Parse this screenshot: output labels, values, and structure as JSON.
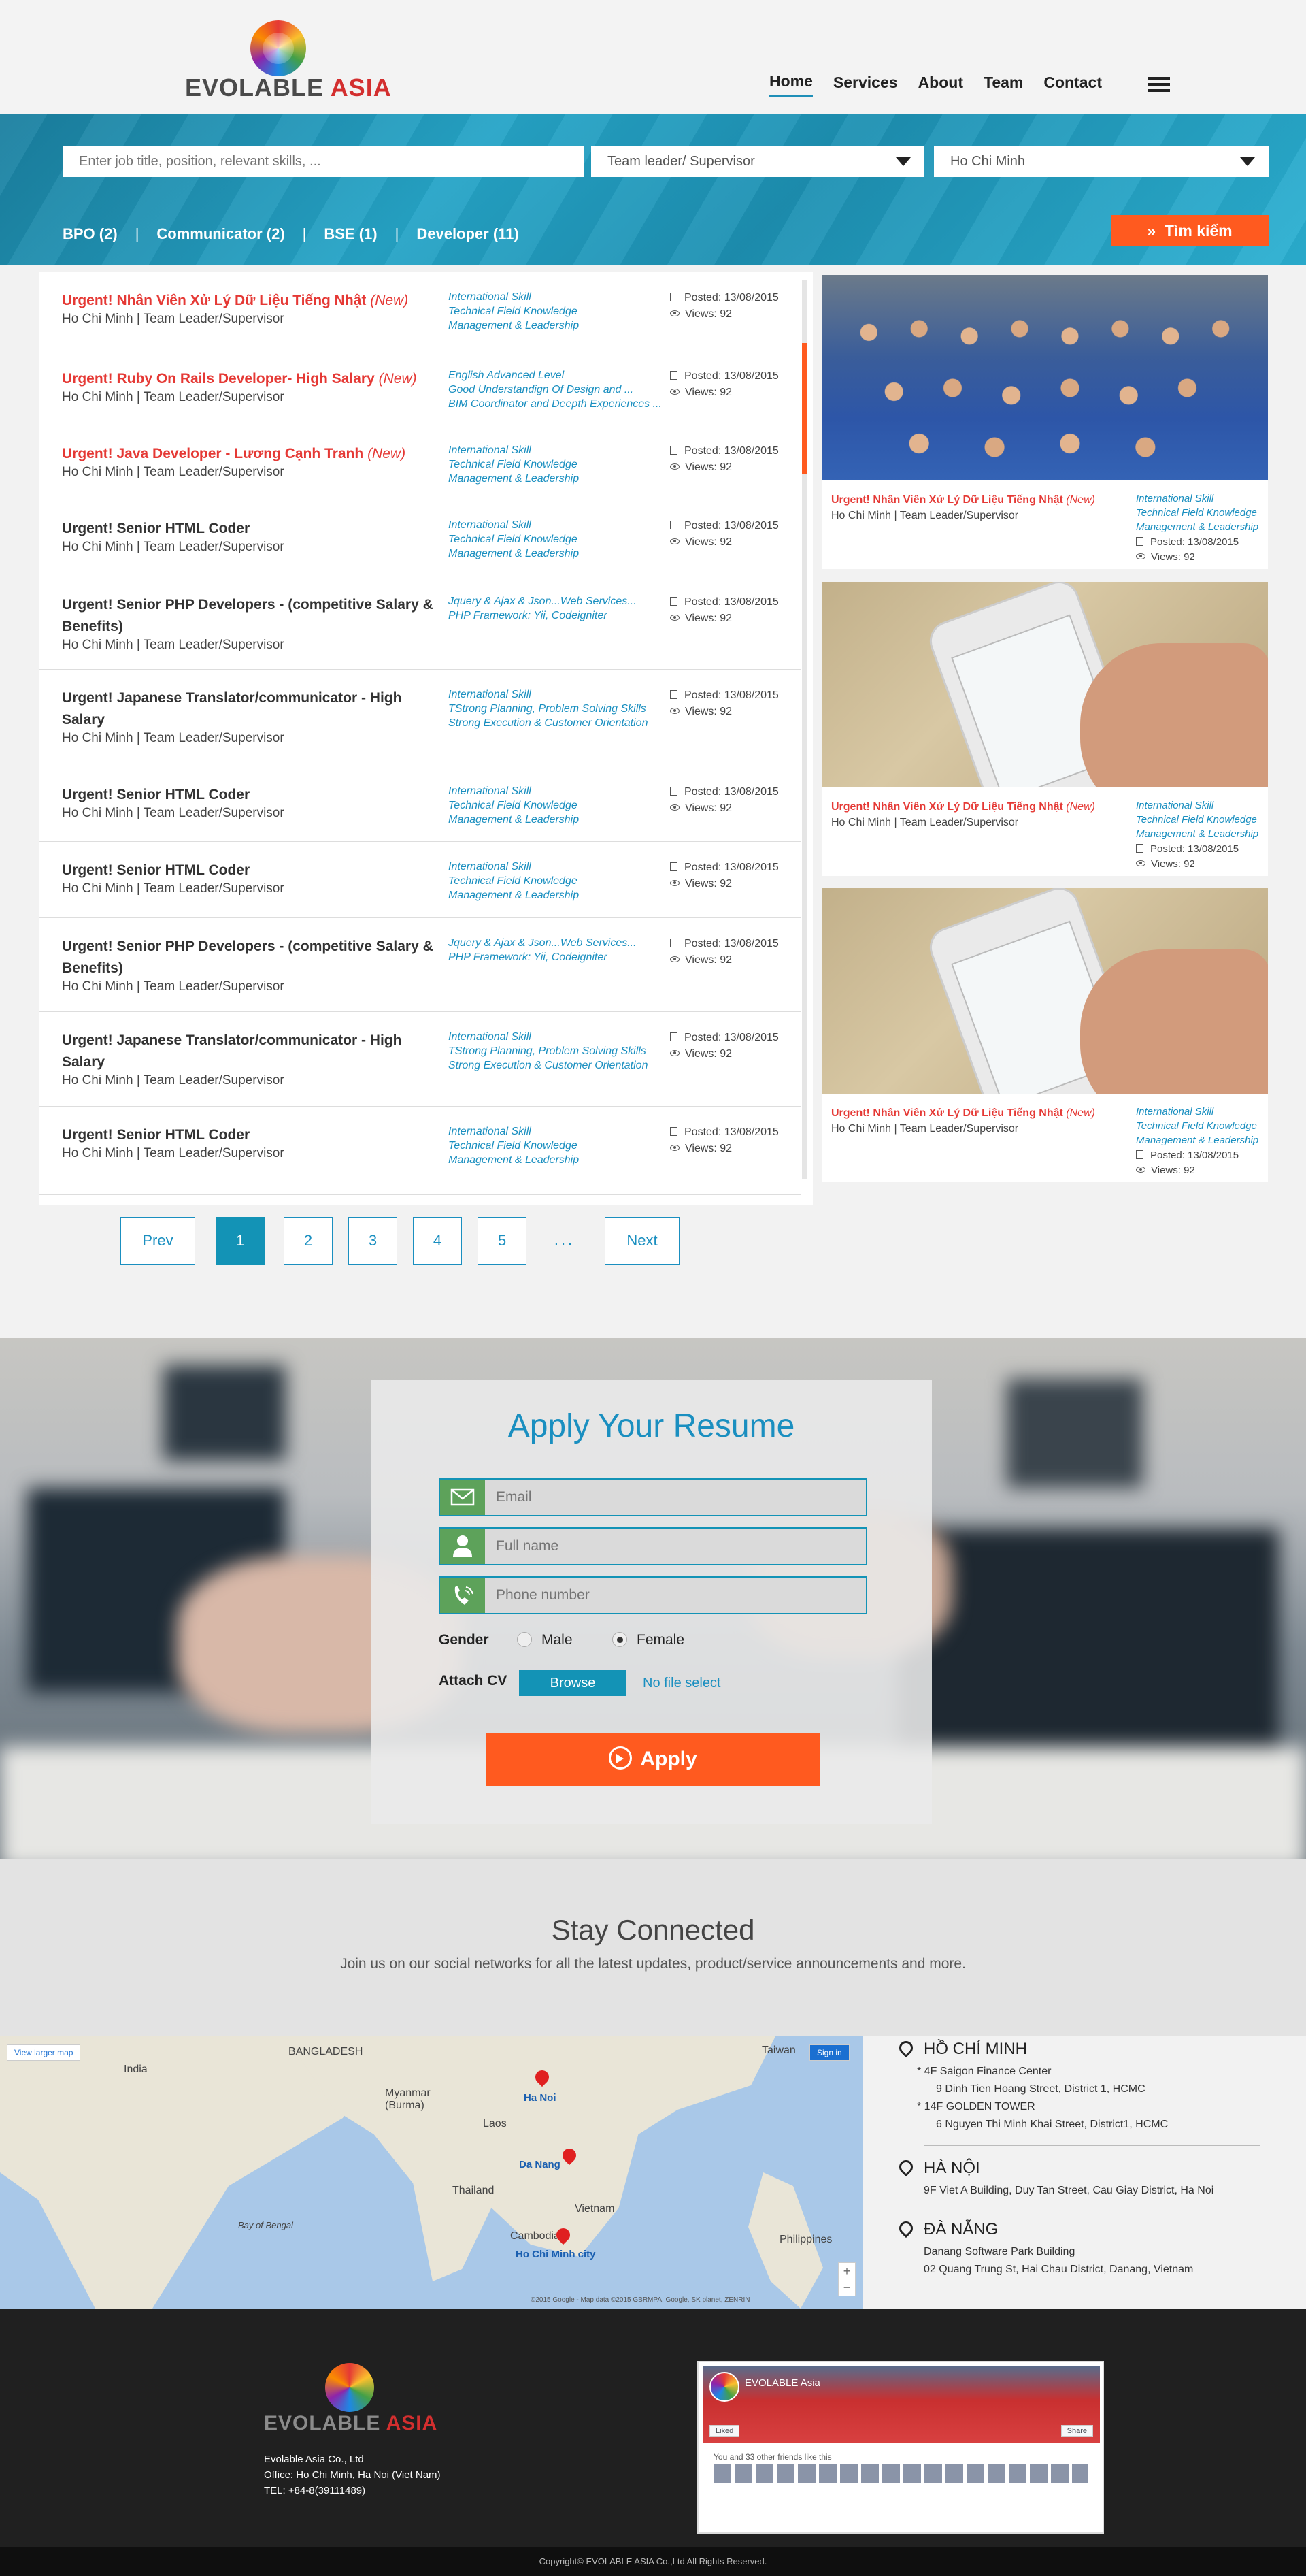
{
  "header": {
    "logo_text": "EVOLABLE",
    "logo_accent": "ASIA",
    "nav": [
      "Home",
      "Services",
      "About",
      "Team",
      "Contact"
    ]
  },
  "search": {
    "keyword_placeholder": "Enter job title, position, relevant skills, ...",
    "position_value": "Team leader/ Supervisor",
    "location_value": "Ho Chi Minh",
    "filters": [
      "BPO (2)",
      "Communicator (2)",
      "BSE (1)",
      "Developer (11)"
    ],
    "search_label": "Tìm kiếm"
  },
  "jobs": [
    {
      "title": "Urgent! Nhân Viên Xử Lý Dữ Liệu Tiếng Nhật",
      "new": "(New)",
      "sub": "Ho Chi Minh | Team Leader/Supervisor",
      "skills": [
        "International Skill",
        "Technical Field Knowledge",
        "Management & Leadership"
      ],
      "posted": "Posted: 13/08/2015",
      "views": "Views: 92"
    },
    {
      "title": "Urgent! Ruby On Rails Developer- High Salary",
      "new": "(New)",
      "sub": "Ho Chi Minh | Team Leader/Supervisor",
      "skills": [
        "English Advanced Level",
        "Good Understandign Of Design and ...",
        "BIM Coordinator and Deepth Experiences ..."
      ],
      "posted": "Posted: 13/08/2015",
      "views": "Views: 92"
    },
    {
      "title": "Urgent! Java Developer - Lương Cạnh Tranh",
      "new": "(New)",
      "sub": "Ho Chi Minh | Team Leader/Supervisor",
      "skills": [
        "International Skill",
        "Technical Field Knowledge",
        "Management & Leadership"
      ],
      "posted": "Posted: 13/08/2015",
      "views": "Views: 92"
    },
    {
      "title": "Urgent! Senior HTML Coder",
      "new": "",
      "sub": "Ho Chi Minh | Team Leader/Supervisor",
      "skills": [
        "International Skill",
        "Technical Field Knowledge",
        "Management & Leadership"
      ],
      "posted": "Posted: 13/08/2015",
      "views": "Views: 92"
    },
    {
      "title": "Urgent! Senior PHP Developers - (competitive Salary & Benefits)",
      "new": "",
      "sub": "Ho Chi Minh | Team Leader/Supervisor",
      "skills": [
        "Jquery & Ajax & Json...Web Services...",
        "PHP Framework: Yii, Codeigniter",
        ""
      ],
      "posted": "Posted: 13/08/2015",
      "views": "Views: 92"
    },
    {
      "title": "Urgent! Japanese Translator/communicator - High Salary",
      "new": "",
      "sub": "Ho Chi Minh | Team Leader/Supervisor",
      "skills": [
        "International Skill",
        "TStrong Planning, Problem Solving Skills",
        "Strong Execution & Customer Orientation"
      ],
      "posted": "Posted: 13/08/2015",
      "views": "Views: 92"
    },
    {
      "title": "Urgent! Senior HTML Coder",
      "new": "",
      "sub": "Ho Chi Minh | Team Leader/Supervisor",
      "skills": [
        "International Skill",
        "Technical Field Knowledge",
        "Management & Leadership"
      ],
      "posted": "Posted: 13/08/2015",
      "views": "Views: 92"
    },
    {
      "title": "Urgent! Senior HTML Coder",
      "new": "",
      "sub": "Ho Chi Minh | Team Leader/Supervisor",
      "skills": [
        "International Skill",
        "Technical Field Knowledge",
        "Management & Leadership"
      ],
      "posted": "Posted: 13/08/2015",
      "views": "Views: 92"
    },
    {
      "title": "Urgent! Senior PHP Developers - (competitive Salary & Benefits)",
      "new": "",
      "sub": "Ho Chi Minh | Team Leader/Supervisor",
      "skills": [
        "Jquery & Ajax & Json...Web Services...",
        "PHP Framework: Yii, Codeigniter",
        ""
      ],
      "posted": "Posted: 13/08/2015",
      "views": "Views: 92"
    },
    {
      "title": "Urgent! Japanese Translator/communicator - High Salary",
      "new": "",
      "sub": "Ho Chi Minh | Team Leader/Supervisor",
      "skills": [
        "International Skill",
        "TStrong Planning, Problem Solving Skills",
        "Strong Execution & Customer Orientation"
      ],
      "posted": "Posted: 13/08/2015",
      "views": "Views: 92"
    },
    {
      "title": "Urgent! Senior HTML Coder",
      "new": "",
      "sub": "Ho Chi Minh | Team Leader/Supervisor",
      "skills": [
        "International Skill",
        "Technical Field Knowledge",
        "Management & Leadership"
      ],
      "posted": "Posted: 13/08/2015",
      "views": "Views: 92"
    }
  ],
  "featured": [
    {
      "title": "Urgent! Nhân Viên Xử Lý Dữ Liệu Tiếng Nhật",
      "new": "(New)",
      "sub": "Ho Chi Minh | Team Leader/Supervisor",
      "skills": [
        "International Skill",
        "Technical Field Knowledge",
        "Management & Leadership"
      ],
      "posted": "Posted: 13/08/2015",
      "views": "Views: 92"
    },
    {
      "title": "Urgent! Nhân Viên Xử Lý Dữ Liệu Tiếng Nhật",
      "new": "(New)",
      "sub": "Ho Chi Minh | Team Leader/Supervisor",
      "skills": [
        "International Skill",
        "Technical Field Knowledge",
        "Management & Leadership"
      ],
      "posted": "Posted: 13/08/2015",
      "views": "Views: 92"
    },
    {
      "title": "Urgent! Nhân Viên Xử Lý Dữ Liệu Tiếng Nhật",
      "new": "(New)",
      "sub": "Ho Chi Minh | Team Leader/Supervisor",
      "skills": [
        "International Skill",
        "Technical Field Knowledge",
        "Management & Leadership"
      ],
      "posted": "Posted: 13/08/2015",
      "views": "Views: 92"
    }
  ],
  "pagination": {
    "prev": "Prev",
    "pages": [
      "1",
      "2",
      "3",
      "4",
      "5"
    ],
    "dots": "...",
    "next": "Next"
  },
  "apply": {
    "title": "Apply Your Resume",
    "email_placeholder": "Email",
    "name_placeholder": "Full name",
    "phone_placeholder": "Phone number",
    "gender_label": "Gender",
    "male": "Male",
    "female": "Female",
    "attach_label": "Attach CV",
    "browse": "Browse",
    "no_file": "No file select",
    "apply_button": "Apply"
  },
  "stay": {
    "title": "Stay Connected",
    "subtitle": "Join us on our social networks for all the latest updates, product/service announcements and more."
  },
  "map": {
    "view_larger": "View larger map",
    "sign_in": "Sign in",
    "labels": [
      "India",
      "BANGLADESH",
      "Myanmar (Burma)",
      "Laos",
      "Thailand",
      "Cambodia",
      "Vietnam",
      "Philippines",
      "Taiwan",
      "Bay of Bengal"
    ],
    "cities": [
      "Ha Noi",
      "Da Nang",
      "Ho Chi Minh city"
    ],
    "attribution": "©2015 Google - Map data ©2015 GBRMPA, Google, SK planet, ZENRIN"
  },
  "offices": [
    {
      "name": "HỒ CHÍ MINH",
      "lines": [
        "* 4F Saigon Finance Center",
        "9 Dinh Tien Hoang Street, District 1, HCMC",
        "* 14F GOLDEN TOWER",
        "6 Nguyen Thi Minh Khai Street, District1, HCMC"
      ]
    },
    {
      "name": "HÀ NỘI",
      "lines": [
        "9F Viet A Building, Duy Tan Street, Cau Giay District, Ha Noi"
      ]
    },
    {
      "name": "ĐÀ NẴNG",
      "lines": [
        "Danang Software Park Building",
        "02 Quang Trung St, Hai Chau District, Danang, Vietnam"
      ]
    }
  ],
  "footer": {
    "logo_text": "EVOLABLE",
    "logo_accent": "ASIA",
    "company": "Evolable Asia Co., Ltd",
    "office": "Office: Ho Chi Minh, Ha Noi (Viet Nam)",
    "tel": "TEL: +84-8(39111489)",
    "fb_name": "EVOLABLE Asia",
    "fb_like": "Liked",
    "fb_share": "Share",
    "fb_friends": "You and 33 other friends like this",
    "copyright": "Copyright© EVOLABLE ASIA Co.,Ltd All Rights Reserved."
  },
  "colors": {
    "accent": "#1393b6",
    "cta": "#ff5a1f",
    "new_red": "#e53935",
    "skill_blue": "#1a8fc0"
  }
}
